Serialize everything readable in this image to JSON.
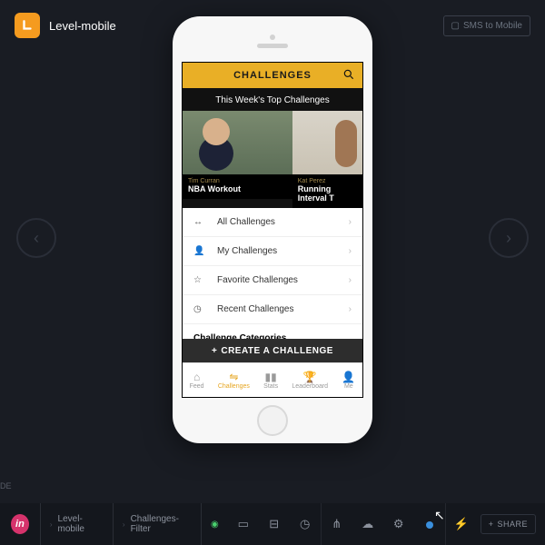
{
  "header": {
    "app_name": "Level-mobile",
    "sms_label": "SMS to Mobile"
  },
  "phone": {
    "bar_title": "CHALLENGES",
    "section_title": "This Week's Top Challenges",
    "cards": [
      {
        "author": "Tim Curran",
        "title": "NBA Workout"
      },
      {
        "author": "Kat Perez",
        "title": "Running Interval T"
      }
    ],
    "menu": [
      {
        "icon": "↔",
        "label": "All Challenges"
      },
      {
        "icon": "👤",
        "label": "My Challenges"
      },
      {
        "icon": "☆",
        "label": "Favorite Challenges"
      },
      {
        "icon": "◷",
        "label": "Recent Challenges"
      }
    ],
    "categories_heading": "Challenge Categories",
    "create_label": "CREATE A CHALLENGE",
    "tabs": [
      {
        "icon": "⌂",
        "label": "Feed"
      },
      {
        "icon": "⇋",
        "label": "Challenges"
      },
      {
        "icon": "▮▮",
        "label": "Stats"
      },
      {
        "icon": "🏆",
        "label": "Leaderboard"
      },
      {
        "icon": "👤",
        "label": "Me"
      }
    ],
    "active_tab_index": 1
  },
  "footer": {
    "mode_label": "DE",
    "crumbs": [
      "Level-mobile",
      "Challenges-Filter"
    ],
    "share_label": "SHARE"
  }
}
